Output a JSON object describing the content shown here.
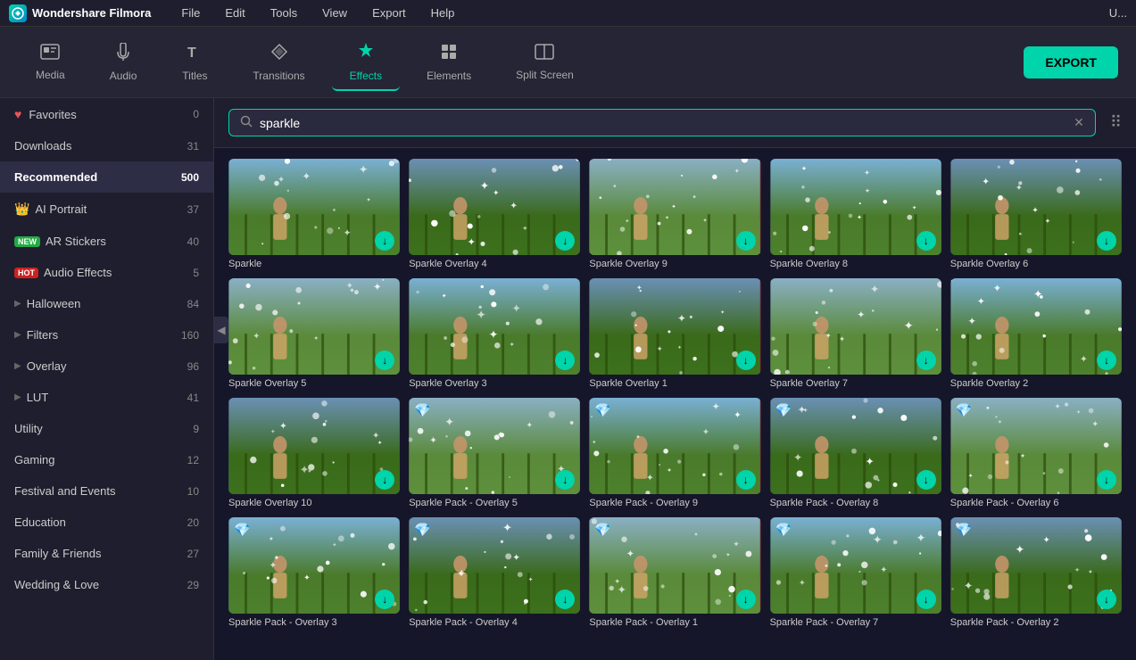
{
  "app": {
    "name": "Wondershare Filmora",
    "logo_text": "F"
  },
  "menu": {
    "items": [
      "File",
      "Edit",
      "Tools",
      "View",
      "Export",
      "Help"
    ],
    "right_label": "U..."
  },
  "toolbar": {
    "tools": [
      {
        "id": "media",
        "label": "Media",
        "icon": "🖥"
      },
      {
        "id": "audio",
        "label": "Audio",
        "icon": "♪"
      },
      {
        "id": "titles",
        "label": "Titles",
        "icon": "T"
      },
      {
        "id": "transitions",
        "label": "Transitions",
        "icon": "⬡"
      },
      {
        "id": "effects",
        "label": "Effects",
        "icon": "✦"
      },
      {
        "id": "elements",
        "label": "Elements",
        "icon": "▦"
      },
      {
        "id": "splitscreen",
        "label": "Split Screen",
        "icon": "▣"
      }
    ],
    "active_tool": "effects",
    "export_label": "EXPORT"
  },
  "sidebar": {
    "items": [
      {
        "id": "favorites",
        "label": "Favorites",
        "count": 0,
        "badge": null,
        "icon": "♡",
        "has_chevron": false
      },
      {
        "id": "downloads",
        "label": "Downloads",
        "count": 31,
        "badge": null,
        "icon": null,
        "has_chevron": false
      },
      {
        "id": "recommended",
        "label": "Recommended",
        "count": 500,
        "badge": null,
        "icon": null,
        "has_chevron": false,
        "active": true
      },
      {
        "id": "ai-portrait",
        "label": "AI Portrait",
        "count": 37,
        "badge": "crown",
        "icon": null,
        "has_chevron": false
      },
      {
        "id": "ar-stickers",
        "label": "AR Stickers",
        "count": 40,
        "badge": "new",
        "icon": null,
        "has_chevron": false
      },
      {
        "id": "audio-effects",
        "label": "Audio Effects",
        "count": 5,
        "badge": "hot",
        "icon": null,
        "has_chevron": false
      },
      {
        "id": "halloween",
        "label": "Halloween",
        "count": 84,
        "badge": null,
        "icon": null,
        "has_chevron": true
      },
      {
        "id": "filters",
        "label": "Filters",
        "count": 160,
        "badge": null,
        "icon": null,
        "has_chevron": true
      },
      {
        "id": "overlay",
        "label": "Overlay",
        "count": 96,
        "badge": null,
        "icon": null,
        "has_chevron": true
      },
      {
        "id": "lut",
        "label": "LUT",
        "count": 41,
        "badge": null,
        "icon": null,
        "has_chevron": true
      },
      {
        "id": "utility",
        "label": "Utility",
        "count": 9,
        "badge": null,
        "icon": null,
        "has_chevron": false
      },
      {
        "id": "gaming",
        "label": "Gaming",
        "count": 12,
        "badge": null,
        "icon": null,
        "has_chevron": false
      },
      {
        "id": "festival-events",
        "label": "Festival and Events",
        "count": 10,
        "badge": null,
        "icon": null,
        "has_chevron": false
      },
      {
        "id": "education",
        "label": "Education",
        "count": 20,
        "badge": null,
        "icon": null,
        "has_chevron": false
      },
      {
        "id": "family-friends",
        "label": "Family & Friends",
        "count": 27,
        "badge": null,
        "icon": null,
        "has_chevron": false
      },
      {
        "id": "wedding-love",
        "label": "Wedding & Love",
        "count": 29,
        "badge": null,
        "icon": null,
        "has_chevron": false
      }
    ]
  },
  "search": {
    "placeholder": "Search",
    "value": "sparkle"
  },
  "grid": {
    "items": [
      {
        "id": 1,
        "label": "Sparkle",
        "premium": false,
        "row": 1
      },
      {
        "id": 2,
        "label": "Sparkle Overlay 4",
        "premium": false,
        "row": 1
      },
      {
        "id": 3,
        "label": "Sparkle Overlay 9",
        "premium": false,
        "row": 1
      },
      {
        "id": 4,
        "label": "Sparkle Overlay 8",
        "premium": false,
        "row": 1
      },
      {
        "id": 5,
        "label": "Sparkle Overlay 6",
        "premium": false,
        "row": 1
      },
      {
        "id": 6,
        "label": "Sparkle Overlay 5",
        "premium": false,
        "row": 2
      },
      {
        "id": 7,
        "label": "Sparkle Overlay 3",
        "premium": false,
        "row": 2
      },
      {
        "id": 8,
        "label": "Sparkle Overlay 1",
        "premium": false,
        "row": 2
      },
      {
        "id": 9,
        "label": "Sparkle Overlay 7",
        "premium": false,
        "row": 2
      },
      {
        "id": 10,
        "label": "Sparkle Overlay 2",
        "premium": false,
        "row": 2
      },
      {
        "id": 11,
        "label": "Sparkle Overlay 10",
        "premium": false,
        "row": 3
      },
      {
        "id": 12,
        "label": "Sparkle Pack - Overlay 5",
        "premium": true,
        "row": 3
      },
      {
        "id": 13,
        "label": "Sparkle Pack - Overlay 9",
        "premium": true,
        "row": 3
      },
      {
        "id": 14,
        "label": "Sparkle Pack - Overlay 8",
        "premium": true,
        "row": 3
      },
      {
        "id": 15,
        "label": "Sparkle Pack - Overlay 6",
        "premium": true,
        "row": 3
      },
      {
        "id": 16,
        "label": "Sparkle Pack - Overlay 3",
        "premium": true,
        "row": 4
      },
      {
        "id": 17,
        "label": "Sparkle Pack - Overlay 4",
        "premium": true,
        "row": 4
      },
      {
        "id": 18,
        "label": "Sparkle Pack - Overlay 1",
        "premium": true,
        "row": 4
      },
      {
        "id": 19,
        "label": "Sparkle Pack - Overlay 7",
        "premium": true,
        "row": 4
      },
      {
        "id": 20,
        "label": "Sparkle Pack - Overlay 2",
        "premium": true,
        "row": 4
      }
    ]
  },
  "colors": {
    "accent": "#00d4aa",
    "premium_diamond": "💎",
    "bg_dark": "#1a1a2e",
    "bg_sidebar": "#1e1e2e"
  }
}
